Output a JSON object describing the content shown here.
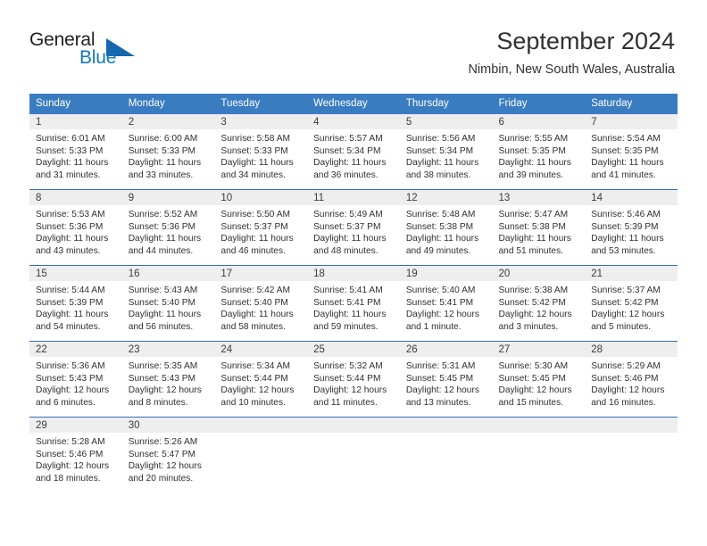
{
  "brand": {
    "name_primary": "General",
    "name_secondary": "Blue",
    "triangle_color": "#1568ad",
    "accent_color": "#3a7cc0"
  },
  "header": {
    "title": "September 2024",
    "location": "Nimbin, New South Wales, Australia"
  },
  "calendar": {
    "weekday_headers": [
      "Sunday",
      "Monday",
      "Tuesday",
      "Wednesday",
      "Thursday",
      "Friday",
      "Saturday"
    ],
    "header_bg": "#3a7cc0",
    "day_band_bg": "#eeeeee",
    "row_border_color": "#2f6fb5",
    "weeks": [
      [
        {
          "day": "1",
          "sunrise": "Sunrise: 6:01 AM",
          "sunset": "Sunset: 5:33 PM",
          "daylight_line1": "Daylight: 11 hours",
          "daylight_line2": "and 31 minutes."
        },
        {
          "day": "2",
          "sunrise": "Sunrise: 6:00 AM",
          "sunset": "Sunset: 5:33 PM",
          "daylight_line1": "Daylight: 11 hours",
          "daylight_line2": "and 33 minutes."
        },
        {
          "day": "3",
          "sunrise": "Sunrise: 5:58 AM",
          "sunset": "Sunset: 5:33 PM",
          "daylight_line1": "Daylight: 11 hours",
          "daylight_line2": "and 34 minutes."
        },
        {
          "day": "4",
          "sunrise": "Sunrise: 5:57 AM",
          "sunset": "Sunset: 5:34 PM",
          "daylight_line1": "Daylight: 11 hours",
          "daylight_line2": "and 36 minutes."
        },
        {
          "day": "5",
          "sunrise": "Sunrise: 5:56 AM",
          "sunset": "Sunset: 5:34 PM",
          "daylight_line1": "Daylight: 11 hours",
          "daylight_line2": "and 38 minutes."
        },
        {
          "day": "6",
          "sunrise": "Sunrise: 5:55 AM",
          "sunset": "Sunset: 5:35 PM",
          "daylight_line1": "Daylight: 11 hours",
          "daylight_line2": "and 39 minutes."
        },
        {
          "day": "7",
          "sunrise": "Sunrise: 5:54 AM",
          "sunset": "Sunset: 5:35 PM",
          "daylight_line1": "Daylight: 11 hours",
          "daylight_line2": "and 41 minutes."
        }
      ],
      [
        {
          "day": "8",
          "sunrise": "Sunrise: 5:53 AM",
          "sunset": "Sunset: 5:36 PM",
          "daylight_line1": "Daylight: 11 hours",
          "daylight_line2": "and 43 minutes."
        },
        {
          "day": "9",
          "sunrise": "Sunrise: 5:52 AM",
          "sunset": "Sunset: 5:36 PM",
          "daylight_line1": "Daylight: 11 hours",
          "daylight_line2": "and 44 minutes."
        },
        {
          "day": "10",
          "sunrise": "Sunrise: 5:50 AM",
          "sunset": "Sunset: 5:37 PM",
          "daylight_line1": "Daylight: 11 hours",
          "daylight_line2": "and 46 minutes."
        },
        {
          "day": "11",
          "sunrise": "Sunrise: 5:49 AM",
          "sunset": "Sunset: 5:37 PM",
          "daylight_line1": "Daylight: 11 hours",
          "daylight_line2": "and 48 minutes."
        },
        {
          "day": "12",
          "sunrise": "Sunrise: 5:48 AM",
          "sunset": "Sunset: 5:38 PM",
          "daylight_line1": "Daylight: 11 hours",
          "daylight_line2": "and 49 minutes."
        },
        {
          "day": "13",
          "sunrise": "Sunrise: 5:47 AM",
          "sunset": "Sunset: 5:38 PM",
          "daylight_line1": "Daylight: 11 hours",
          "daylight_line2": "and 51 minutes."
        },
        {
          "day": "14",
          "sunrise": "Sunrise: 5:46 AM",
          "sunset": "Sunset: 5:39 PM",
          "daylight_line1": "Daylight: 11 hours",
          "daylight_line2": "and 53 minutes."
        }
      ],
      [
        {
          "day": "15",
          "sunrise": "Sunrise: 5:44 AM",
          "sunset": "Sunset: 5:39 PM",
          "daylight_line1": "Daylight: 11 hours",
          "daylight_line2": "and 54 minutes."
        },
        {
          "day": "16",
          "sunrise": "Sunrise: 5:43 AM",
          "sunset": "Sunset: 5:40 PM",
          "daylight_line1": "Daylight: 11 hours",
          "daylight_line2": "and 56 minutes."
        },
        {
          "day": "17",
          "sunrise": "Sunrise: 5:42 AM",
          "sunset": "Sunset: 5:40 PM",
          "daylight_line1": "Daylight: 11 hours",
          "daylight_line2": "and 58 minutes."
        },
        {
          "day": "18",
          "sunrise": "Sunrise: 5:41 AM",
          "sunset": "Sunset: 5:41 PM",
          "daylight_line1": "Daylight: 11 hours",
          "daylight_line2": "and 59 minutes."
        },
        {
          "day": "19",
          "sunrise": "Sunrise: 5:40 AM",
          "sunset": "Sunset: 5:41 PM",
          "daylight_line1": "Daylight: 12 hours",
          "daylight_line2": "and 1 minute."
        },
        {
          "day": "20",
          "sunrise": "Sunrise: 5:38 AM",
          "sunset": "Sunset: 5:42 PM",
          "daylight_line1": "Daylight: 12 hours",
          "daylight_line2": "and 3 minutes."
        },
        {
          "day": "21",
          "sunrise": "Sunrise: 5:37 AM",
          "sunset": "Sunset: 5:42 PM",
          "daylight_line1": "Daylight: 12 hours",
          "daylight_line2": "and 5 minutes."
        }
      ],
      [
        {
          "day": "22",
          "sunrise": "Sunrise: 5:36 AM",
          "sunset": "Sunset: 5:43 PM",
          "daylight_line1": "Daylight: 12 hours",
          "daylight_line2": "and 6 minutes."
        },
        {
          "day": "23",
          "sunrise": "Sunrise: 5:35 AM",
          "sunset": "Sunset: 5:43 PM",
          "daylight_line1": "Daylight: 12 hours",
          "daylight_line2": "and 8 minutes."
        },
        {
          "day": "24",
          "sunrise": "Sunrise: 5:34 AM",
          "sunset": "Sunset: 5:44 PM",
          "daylight_line1": "Daylight: 12 hours",
          "daylight_line2": "and 10 minutes."
        },
        {
          "day": "25",
          "sunrise": "Sunrise: 5:32 AM",
          "sunset": "Sunset: 5:44 PM",
          "daylight_line1": "Daylight: 12 hours",
          "daylight_line2": "and 11 minutes."
        },
        {
          "day": "26",
          "sunrise": "Sunrise: 5:31 AM",
          "sunset": "Sunset: 5:45 PM",
          "daylight_line1": "Daylight: 12 hours",
          "daylight_line2": "and 13 minutes."
        },
        {
          "day": "27",
          "sunrise": "Sunrise: 5:30 AM",
          "sunset": "Sunset: 5:45 PM",
          "daylight_line1": "Daylight: 12 hours",
          "daylight_line2": "and 15 minutes."
        },
        {
          "day": "28",
          "sunrise": "Sunrise: 5:29 AM",
          "sunset": "Sunset: 5:46 PM",
          "daylight_line1": "Daylight: 12 hours",
          "daylight_line2": "and 16 minutes."
        }
      ],
      [
        {
          "day": "29",
          "sunrise": "Sunrise: 5:28 AM",
          "sunset": "Sunset: 5:46 PM",
          "daylight_line1": "Daylight: 12 hours",
          "daylight_line2": "and 18 minutes."
        },
        {
          "day": "30",
          "sunrise": "Sunrise: 5:26 AM",
          "sunset": "Sunset: 5:47 PM",
          "daylight_line1": "Daylight: 12 hours",
          "daylight_line2": "and 20 minutes."
        },
        {
          "day": "",
          "sunrise": "",
          "sunset": "",
          "daylight_line1": "",
          "daylight_line2": ""
        },
        {
          "day": "",
          "sunrise": "",
          "sunset": "",
          "daylight_line1": "",
          "daylight_line2": ""
        },
        {
          "day": "",
          "sunrise": "",
          "sunset": "",
          "daylight_line1": "",
          "daylight_line2": ""
        },
        {
          "day": "",
          "sunrise": "",
          "sunset": "",
          "daylight_line1": "",
          "daylight_line2": ""
        },
        {
          "day": "",
          "sunrise": "",
          "sunset": "",
          "daylight_line1": "",
          "daylight_line2": ""
        }
      ]
    ]
  }
}
